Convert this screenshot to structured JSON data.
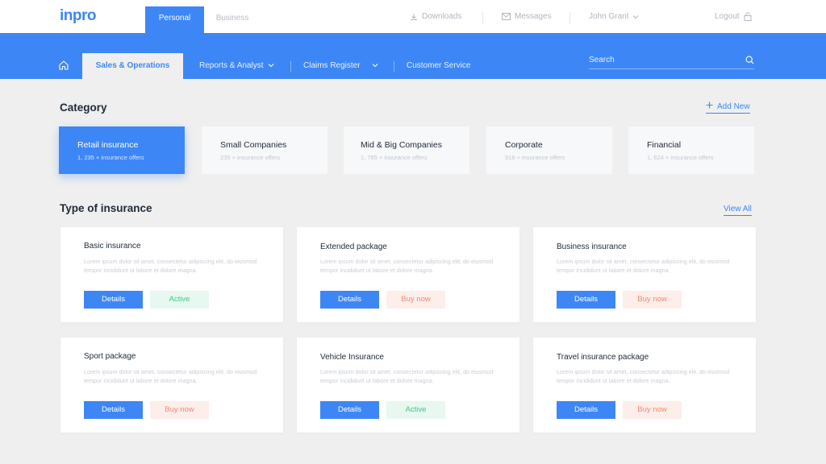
{
  "brand": {
    "logo_text": "inpro"
  },
  "account_tabs": {
    "personal": "Personal",
    "business": "Business"
  },
  "top_links": {
    "downloads": "Downloads",
    "messages": "Messages",
    "user": "John Grant",
    "logout": "Logout"
  },
  "nav": {
    "active": "Sales & Operations",
    "reports": "Reports & Analyst",
    "claims": "Claims Register",
    "customer_service": "Customer Service",
    "search_placeholder": "Search"
  },
  "category": {
    "title": "Category",
    "add_new": "Add New",
    "items": [
      {
        "title": "Retail insurance",
        "sub": "1, 235 + insurance offers"
      },
      {
        "title": "Small Companies",
        "sub": "235 + insurance offers"
      },
      {
        "title": "Mid & Big Companies",
        "sub": "1, 785 + insurance offers"
      },
      {
        "title": "Corporate",
        "sub": "916 + insurance offers"
      },
      {
        "title": "Financial",
        "sub": "1, 624 + insurance offers"
      }
    ]
  },
  "insurance": {
    "title": "Type of insurance",
    "view_all": "View All",
    "details_label": "Details",
    "active_label": "Active",
    "buy_label": "Buy now",
    "desc": "Lorem ipsum dolor sit amet, consectetur adipiscing elit, do eiusmod tempor incididunt ut labore et dolore magna.",
    "cards": [
      {
        "title": "Basic insurance",
        "status": "Active"
      },
      {
        "title": "Extended package",
        "status": "Buy now"
      },
      {
        "title": "Business insurance",
        "status": "Buy now"
      },
      {
        "title": "Sport package",
        "status": "Buy now"
      },
      {
        "title": "Vehicle Insurance",
        "status": "Active"
      },
      {
        "title": "Travel insurance package",
        "status": "Buy now"
      }
    ]
  },
  "colors": {
    "accent": "#3d86f5",
    "active_green": "#3dcb86",
    "buy_orange": "#f08a6b"
  }
}
